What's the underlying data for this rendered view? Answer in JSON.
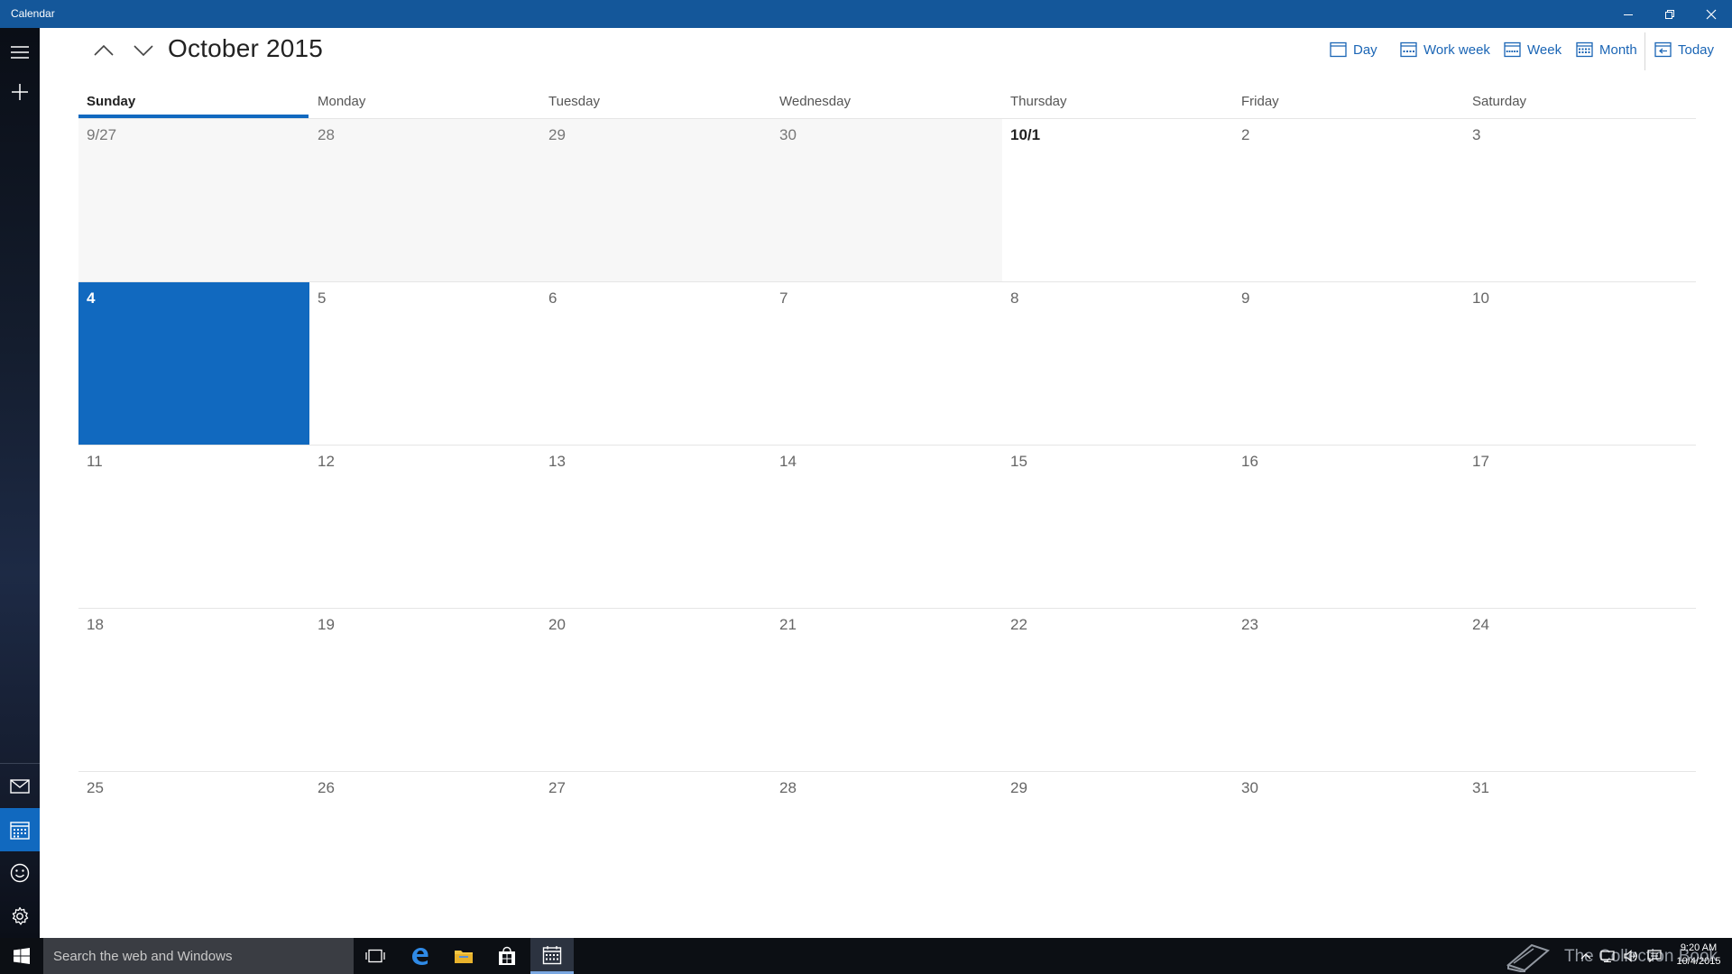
{
  "window": {
    "title": "Calendar",
    "minimize_icon": "minimize-icon",
    "restore_icon": "restore-icon",
    "close_icon": "close-icon"
  },
  "rail": {
    "items": [
      {
        "name": "hamburger-menu",
        "icon": "hamburger-icon"
      },
      {
        "name": "new-event",
        "icon": "plus-icon"
      },
      {
        "name": "mail",
        "icon": "mail-icon"
      },
      {
        "name": "calendar",
        "icon": "calendar-icon",
        "active": true
      },
      {
        "name": "feedback",
        "icon": "smiley-icon"
      },
      {
        "name": "settings",
        "icon": "gear-icon"
      }
    ]
  },
  "header": {
    "month_title": "October 2015",
    "views": [
      {
        "label": "Day",
        "icon": "calendar-day-icon"
      },
      {
        "label": "Work week",
        "icon": "calendar-workweek-icon"
      },
      {
        "label": "Week",
        "icon": "calendar-week-icon"
      },
      {
        "label": "Month",
        "icon": "calendar-month-icon"
      },
      {
        "label": "Today",
        "icon": "calendar-today-icon"
      }
    ]
  },
  "calendar": {
    "days_of_week": [
      "Sunday",
      "Monday",
      "Tuesday",
      "Wednesday",
      "Thursday",
      "Friday",
      "Saturday"
    ],
    "current_day_of_week": "Sunday",
    "today": "4",
    "weeks": [
      [
        "9/27",
        "28",
        "29",
        "30",
        "10/1",
        "2",
        "3"
      ],
      [
        "4",
        "5",
        "6",
        "7",
        "8",
        "9",
        "10"
      ],
      [
        "11",
        "12",
        "13",
        "14",
        "15",
        "16",
        "17"
      ],
      [
        "18",
        "19",
        "20",
        "21",
        "22",
        "23",
        "24"
      ],
      [
        "25",
        "26",
        "27",
        "28",
        "29",
        "30",
        "31"
      ]
    ]
  },
  "taskbar": {
    "search_placeholder": "Search the web and Windows",
    "watermark_text": "The Collection Book",
    "clock_time": "9:20 AM",
    "clock_date": "10/4/2015"
  },
  "colors": {
    "accent": "#1169bf",
    "titlebar": "#14579a",
    "link": "#1a65b5",
    "taskbar": "#0c0f14"
  }
}
